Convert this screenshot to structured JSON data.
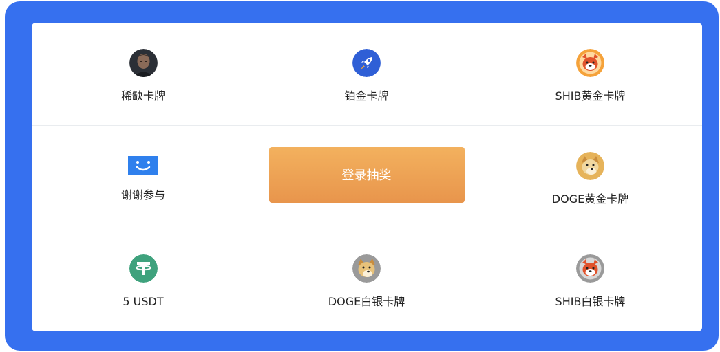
{
  "prizes": [
    {
      "label": "稀缺卡牌",
      "icon": "elon-portrait-icon"
    },
    {
      "label": "铂金卡牌",
      "icon": "rocket-icon"
    },
    {
      "label": "SHIB黄金卡牌",
      "icon": "shib-icon"
    },
    {
      "label": "谢谢参与",
      "icon": "smile-icon"
    },
    {
      "label": "DOGE黄金卡牌",
      "icon": "doge-icon"
    },
    {
      "label": "5 USDT",
      "icon": "tether-icon"
    },
    {
      "label": "DOGE白银卡牌",
      "icon": "doge-icon"
    },
    {
      "label": "SHIB白银卡牌",
      "icon": "shib-icon"
    }
  ],
  "draw_button": {
    "label": "登录抽奖"
  },
  "colors": {
    "frame": "#3670ef",
    "button_top": "#f3b15e",
    "button_bottom": "#e8954c",
    "tether": "#3fa27d",
    "smile": "#2f80ed"
  }
}
